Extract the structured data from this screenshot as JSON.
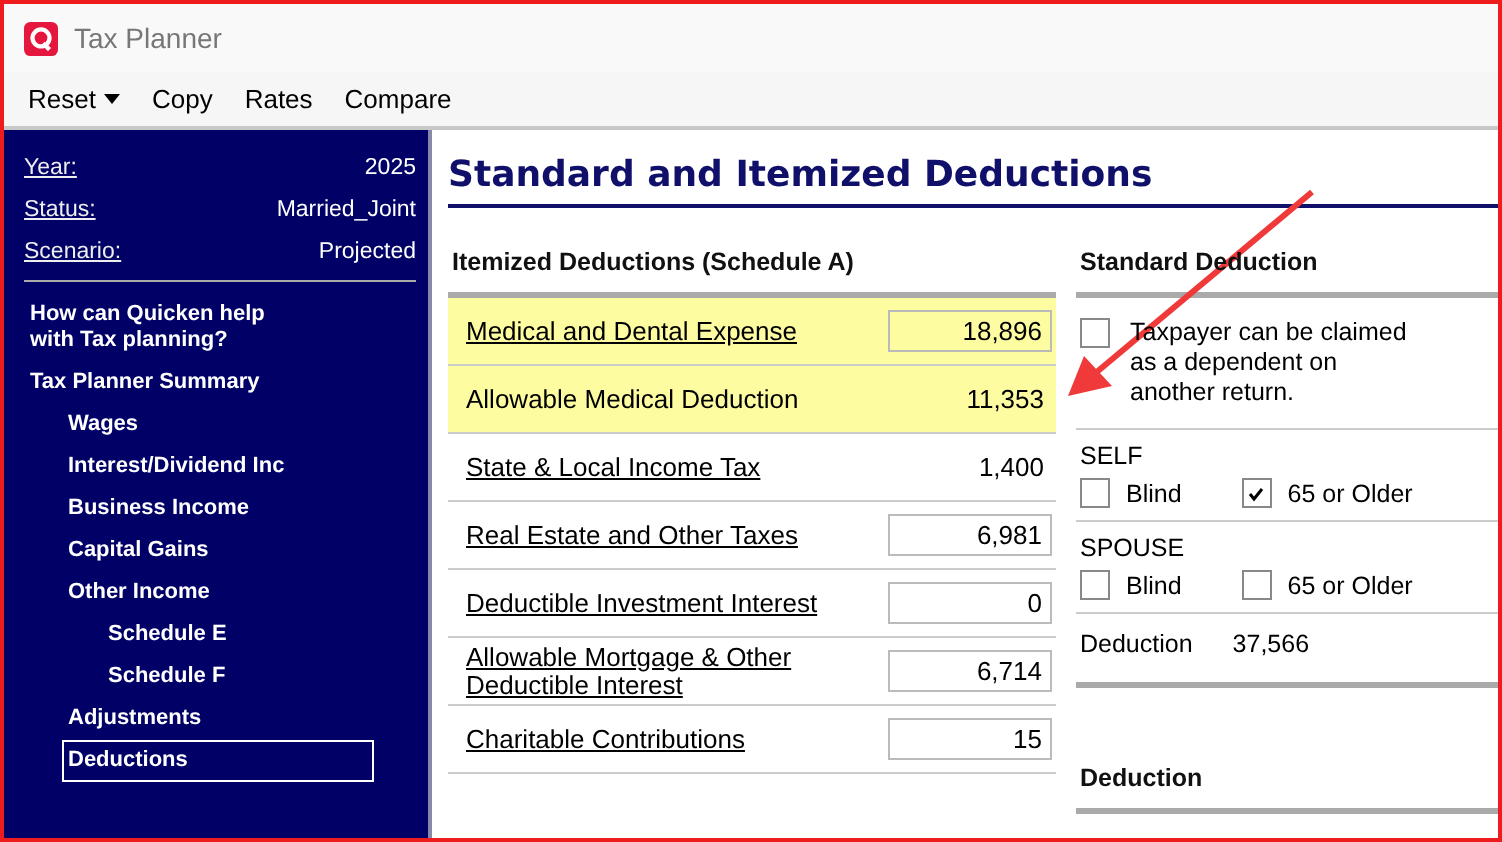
{
  "window": {
    "title": "Tax Planner"
  },
  "menu": [
    {
      "label": "Reset",
      "dropdown": true
    },
    {
      "label": "Copy",
      "dropdown": false
    },
    {
      "label": "Rates",
      "dropdown": false
    },
    {
      "label": "Compare",
      "dropdown": false
    }
  ],
  "sidebar": {
    "fields": [
      {
        "label": "Year:",
        "value": "2025"
      },
      {
        "label": "Status:",
        "value": "Married_Joint"
      },
      {
        "label": "Scenario:",
        "value": "Projected"
      }
    ],
    "items": [
      {
        "label": "How can Quicken help with Tax planning?",
        "selected": false
      },
      {
        "label": "Tax Planner Summary",
        "selected": false,
        "children": [
          {
            "label": "Wages",
            "selected": false
          },
          {
            "label": "Interest/Dividend Inc",
            "selected": false
          },
          {
            "label": "Business Income",
            "selected": false
          },
          {
            "label": "Capital Gains",
            "selected": false
          },
          {
            "label": "Other Income",
            "selected": false,
            "children": [
              {
                "label": "Schedule E",
                "selected": false
              },
              {
                "label": "Schedule F",
                "selected": false
              }
            ]
          },
          {
            "label": "Adjustments",
            "selected": false
          },
          {
            "label": "Deductions",
            "selected": true
          }
        ]
      }
    ]
  },
  "page": {
    "title": "Standard and Itemized Deductions"
  },
  "itemized": {
    "heading": "Itemized Deductions (Schedule A)",
    "rows": [
      {
        "label": "Medical and Dental Expense",
        "value": "18,896",
        "kind": "field",
        "link": true,
        "highlighted": true
      },
      {
        "label": "Allowable Medical Deduction",
        "value": "11,353",
        "kind": "value",
        "link": false,
        "highlighted": true
      },
      {
        "label": "State & Local Income Tax",
        "value": "1,400",
        "kind": "value",
        "link": true,
        "highlighted": false
      },
      {
        "label": "Real Estate and Other Taxes",
        "value": "6,981",
        "kind": "field",
        "link": true,
        "highlighted": false
      },
      {
        "label": "Deductible Investment Interest",
        "value": "0",
        "kind": "field",
        "link": true,
        "highlighted": false
      },
      {
        "label": "Allowable Mortgage & Other Deductible Interest",
        "value": "6,714",
        "kind": "field",
        "link": true,
        "highlighted": false
      },
      {
        "label": "Charitable Contributions",
        "value": "15",
        "kind": "field",
        "link": true,
        "highlighted": false
      }
    ]
  },
  "standard": {
    "heading": "Standard Deduction",
    "dependent": {
      "label": "Taxpayer can be claimed as a dependent on another return.",
      "checked": false
    },
    "groups": [
      {
        "label": "SELF",
        "options": [
          {
            "label": "Blind",
            "checked": false
          },
          {
            "label": "65 or Older",
            "checked": true
          }
        ]
      },
      {
        "label": "SPOUSE",
        "options": [
          {
            "label": "Blind",
            "checked": false
          },
          {
            "label": "65 or Older",
            "checked": false
          }
        ]
      }
    ],
    "deduction_label": "Deduction",
    "deduction_value": "37,566"
  },
  "deduction_section": {
    "heading": "Deduction"
  }
}
